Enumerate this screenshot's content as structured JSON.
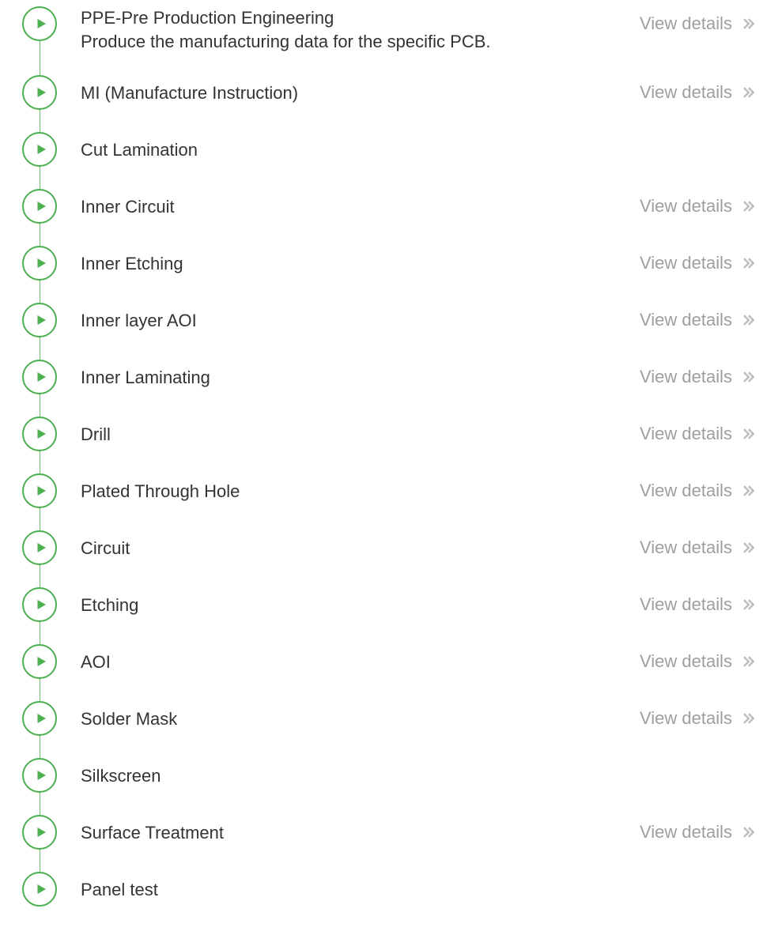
{
  "colors": {
    "green": "#4caf50",
    "linkGrey": "#9e9e9e",
    "textDark": "#333333"
  },
  "viewDetailsLabel": "View details",
  "steps": [
    {
      "title": "PPE-Pre Production Engineering",
      "subtitle": "Produce the manufacturing data for the specific PCB.",
      "hasLink": true
    },
    {
      "title": "MI (Manufacture Instruction)",
      "subtitle": "",
      "hasLink": true
    },
    {
      "title": "Cut Lamination",
      "subtitle": "",
      "hasLink": false
    },
    {
      "title": "Inner Circuit",
      "subtitle": "",
      "hasLink": true
    },
    {
      "title": "Inner Etching",
      "subtitle": "",
      "hasLink": true
    },
    {
      "title": "Inner layer AOI",
      "subtitle": "",
      "hasLink": true
    },
    {
      "title": "Inner Laminating",
      "subtitle": "",
      "hasLink": true
    },
    {
      "title": "Drill",
      "subtitle": "",
      "hasLink": true
    },
    {
      "title": "Plated Through Hole",
      "subtitle": "",
      "hasLink": true
    },
    {
      "title": "Circuit",
      "subtitle": "",
      "hasLink": true
    },
    {
      "title": "Etching",
      "subtitle": "",
      "hasLink": true
    },
    {
      "title": "AOI",
      "subtitle": "",
      "hasLink": true
    },
    {
      "title": "Solder Mask",
      "subtitle": "",
      "hasLink": true
    },
    {
      "title": "Silkscreen",
      "subtitle": "",
      "hasLink": false
    },
    {
      "title": "Surface Treatment",
      "subtitle": "",
      "hasLink": true
    },
    {
      "title": "Panel test",
      "subtitle": "",
      "hasLink": false
    }
  ]
}
